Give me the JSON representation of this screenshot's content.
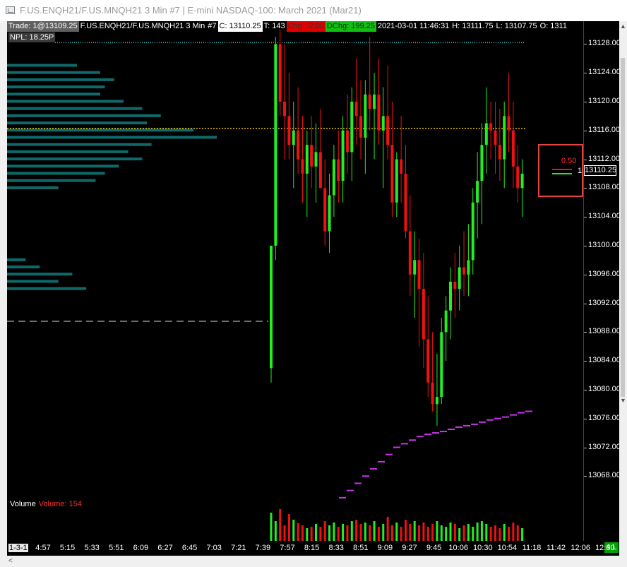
{
  "window": {
    "title": "F.US.ENQH21/F.US.MNQH21  3 Min   #7 | E-mini NASDAQ-100: March 2021 (Mar21)"
  },
  "header": {
    "trade": "Trade: 1@13109.25",
    "symbol": "F.US.ENQH21/F.US.MNQH21  3 Min",
    "number": "#7",
    "close": "C: 13110.25",
    "ticks": "T: 143",
    "chg": "Chg: -2.00",
    "dchg": "DChg: 199.25",
    "datetime": "2021-03-01 11:46:31",
    "high": "H: 13111.75",
    "low": "L: 13107.75",
    "open": "O: 1311"
  },
  "npl": "NPL: 18.25P",
  "volume_label": {
    "name": "Volume",
    "value": "Volume: 154"
  },
  "position": {
    "pnl": "0.50",
    "price_tag": "13110.25",
    "marker": "1"
  },
  "price_axis": {
    "ticks": [
      "13128.00",
      "13124.00",
      "13120.00",
      "13116.00",
      "13112.00",
      "13108.00",
      "13104.00",
      "13100.00",
      "13096.00",
      "13092.00",
      "13088.00",
      "13084.00",
      "13080.00",
      "13076.00",
      "13072.00",
      "13068.00"
    ]
  },
  "time_axis": {
    "first": "1-3-1",
    "labels": [
      "4:57",
      "5:15",
      "5:33",
      "5:51",
      "6:09",
      "6:27",
      "6:45",
      "7:03",
      "7:21",
      "7:39",
      "7:57",
      "8:15",
      "8:33",
      "8:51",
      "9:09",
      "9:27",
      "9:45",
      "10:06",
      "10:30",
      "10:54",
      "11:18",
      "11:42",
      "12:06",
      "12:30"
    ],
    "bars_badge": "4 L"
  },
  "colors": {
    "up": "#22ee22",
    "down": "#ee1111",
    "profile": "#0e6a6a",
    "vwap": "#cc33ee",
    "poc": "#e6b800",
    "npl_line": "#30c8c8",
    "dash": "#d8d8d8"
  },
  "chart_data": {
    "type": "candlestick",
    "price_range": [
      13064.5,
      13130.0
    ],
    "x": [
      "8:15",
      "8:18",
      "8:21",
      "8:24",
      "8:27",
      "8:30",
      "8:33",
      "8:36",
      "8:39",
      "8:42",
      "8:45",
      "8:48",
      "8:51",
      "8:54",
      "8:57",
      "9:00",
      "9:03",
      "9:06",
      "9:09",
      "9:12",
      "9:15",
      "9:18",
      "9:21",
      "9:24",
      "9:27",
      "9:30",
      "9:33",
      "9:36",
      "9:39",
      "9:42",
      "9:45",
      "9:48",
      "9:51",
      "9:54",
      "9:57",
      "10:00",
      "10:03",
      "10:06",
      "10:09",
      "10:12",
      "10:15",
      "10:18",
      "10:21",
      "10:24",
      "10:27",
      "10:30",
      "10:33",
      "10:36",
      "10:39",
      "10:42",
      "10:45",
      "10:48",
      "10:51",
      "10:54",
      "10:57",
      "11:00",
      "11:03",
      "11:06",
      "11:09",
      "11:12",
      "11:15",
      "11:18",
      "11:21",
      "11:24",
      "11:27",
      "11:30",
      "11:33",
      "11:36",
      "11:39",
      "11:42",
      "11:45"
    ],
    "candles": [
      [
        13083,
        13100,
        13081,
        13100
      ],
      [
        13100,
        13129,
        13098,
        13128
      ],
      [
        13128,
        13130,
        13118,
        13120
      ],
      [
        13120,
        13128,
        13112,
        13118
      ],
      [
        13118,
        13124,
        13112,
        13114
      ],
      [
        13114,
        13120,
        13108,
        13116
      ],
      [
        13116,
        13122,
        13110,
        13112
      ],
      [
        13112,
        13118,
        13106,
        13110
      ],
      [
        13110,
        13116,
        13104,
        13114
      ],
      [
        13114,
        13118,
        13108,
        13111
      ],
      [
        13111,
        13117,
        13106,
        13113
      ],
      [
        13113,
        13119,
        13108,
        13108
      ],
      [
        13108,
        13112,
        13100,
        13102
      ],
      [
        13102,
        13110,
        13099,
        13107
      ],
      [
        13107,
        13114,
        13104,
        13112
      ],
      [
        13112,
        13116,
        13106,
        13109
      ],
      [
        13109,
        13118,
        13106,
        13116
      ],
      [
        13116,
        13121,
        13110,
        13113
      ],
      [
        13113,
        13122,
        13109,
        13120
      ],
      [
        13120,
        13126,
        13114,
        13118
      ],
      [
        13118,
        13123,
        13112,
        13115
      ],
      [
        13115,
        13123,
        13110,
        13121
      ],
      [
        13121,
        13129,
        13116,
        13119
      ],
      [
        13119,
        13124,
        13112,
        13121
      ],
      [
        13121,
        13126,
        13114,
        13116
      ],
      [
        13116,
        13122,
        13108,
        13118
      ],
      [
        13118,
        13125,
        13112,
        13114
      ],
      [
        13114,
        13120,
        13104,
        13106
      ],
      [
        13106,
        13113,
        13104,
        13112
      ],
      [
        13112,
        13118,
        13106,
        13110
      ],
      [
        13110,
        13114,
        13101,
        13102
      ],
      [
        13102,
        13107,
        13093,
        13096
      ],
      [
        13096,
        13102,
        13090,
        13098
      ],
      [
        13098,
        13101,
        13086,
        13094
      ],
      [
        13094,
        13099,
        13083,
        13087
      ],
      [
        13087,
        13093,
        13079,
        13081
      ],
      [
        13081,
        13088,
        13077,
        13078
      ],
      [
        13078,
        13085,
        13075,
        13079
      ],
      [
        13079,
        13090,
        13078,
        13088
      ],
      [
        13088,
        13093,
        13084,
        13091
      ],
      [
        13091,
        13097,
        13087,
        13095
      ],
      [
        13095,
        13099,
        13090,
        13094
      ],
      [
        13094,
        13100,
        13091,
        13097
      ],
      [
        13097,
        13102,
        13093,
        13096
      ],
      [
        13096,
        13103,
        13093,
        13098
      ],
      [
        13098,
        13108,
        13096,
        13106
      ],
      [
        13106,
        13113,
        13101,
        13109
      ],
      [
        13109,
        13117,
        13103,
        13114
      ],
      [
        13114,
        13122,
        13110,
        13117
      ],
      [
        13117,
        13120,
        13112,
        13116
      ],
      [
        13116,
        13120,
        13110,
        13114
      ],
      [
        13114,
        13119,
        13109,
        13112
      ],
      [
        13112,
        13120,
        13108,
        13118
      ],
      [
        13118,
        13124,
        13113,
        13116
      ],
      [
        13116,
        13120,
        13108,
        13111
      ],
      [
        13111,
        13114,
        13106,
        13108
      ],
      [
        13108,
        13112,
        13104,
        13110
      ]
    ],
    "volume": [
      40,
      28,
      45,
      22,
      38,
      30,
      25,
      22,
      18,
      20,
      24,
      20,
      28,
      22,
      26,
      20,
      24,
      22,
      28,
      30,
      24,
      26,
      22,
      28,
      20,
      24,
      34,
      22,
      26,
      20,
      30,
      24,
      28,
      22,
      26,
      20,
      24,
      28,
      22,
      20,
      26,
      24,
      18,
      22,
      24,
      20,
      26,
      28,
      24,
      20,
      22,
      18,
      24,
      20,
      26,
      22,
      18
    ],
    "vwap": [
      13065,
      13066,
      13067,
      13068,
      13069,
      13070,
      13071,
      13072,
      13072.5,
      13073,
      13073.5,
      13073.8,
      13074,
      13074.2,
      13074.5,
      13074.8,
      13075,
      13075.2,
      13075.5,
      13075.8,
      13076,
      13076.2,
      13076.5,
      13076.8,
      13077
    ],
    "volume_profile_levels": [
      13125,
      13124,
      13123,
      13122,
      13121,
      13120,
      13119,
      13118,
      13117,
      13116,
      13115,
      13114,
      13113,
      13112,
      13111,
      13110,
      13109,
      13108,
      13098,
      13097,
      13096,
      13095,
      13094
    ],
    "volume_profile_sizes": [
      30,
      40,
      46,
      42,
      40,
      50,
      58,
      66,
      60,
      80,
      90,
      62,
      52,
      58,
      48,
      42,
      38,
      22,
      8,
      14,
      28,
      22,
      34
    ],
    "poc_price": 13116.3,
    "dashed_level": 13089.5,
    "npl_level": 13128.2
  }
}
